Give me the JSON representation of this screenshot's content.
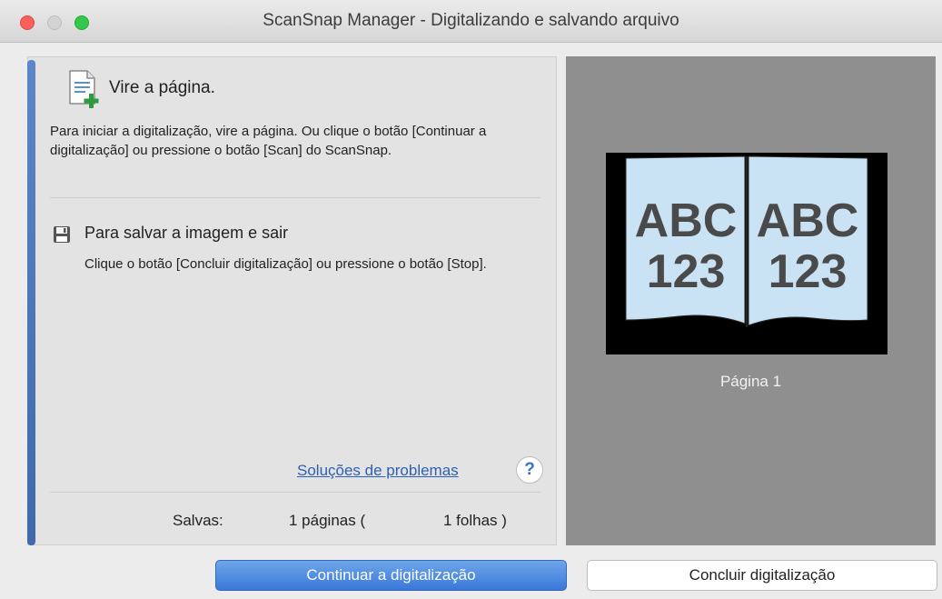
{
  "window": {
    "title": "ScanSnap Manager - Digitalizando e salvando arquivo"
  },
  "step": {
    "title": "Vire a página.",
    "description": "Para iniciar a digitalização, vire a página. Ou clique o botão [Continuar a digitalização] ou pressione o botão [Scan] do ScanSnap.",
    "icon": "document-add-icon"
  },
  "save": {
    "title": "Para salvar a imagem e sair",
    "description": "Clique o botão [Concluir digitalização] ou pressione o botão [Stop].",
    "icon": "floppy-disk-icon"
  },
  "help": {
    "link_label": "Soluções de problemas",
    "button_label": "?"
  },
  "status": {
    "saved_label": "Salvas:",
    "pages": "1 páginas (",
    "sheets": "1 folhas )"
  },
  "preview": {
    "left_page_line1": "ABC",
    "left_page_line2": "123",
    "right_page_line1": "ABC",
    "right_page_line2": "123",
    "page_label": "Página 1"
  },
  "buttons": {
    "continue_label": "Continuar a digitalização",
    "finish_label": "Concluir digitalização"
  },
  "colors": {
    "accent": "#3a78d8",
    "link": "#2f5fb3",
    "preview_bg": "#8f8f8f",
    "page_fill": "#c9e3f5"
  }
}
